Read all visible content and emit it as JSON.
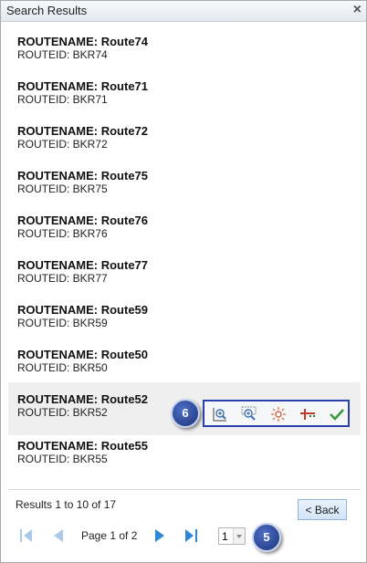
{
  "window": {
    "title": "Search Results",
    "close_label": "×"
  },
  "results": [
    {
      "name": "ROUTENAME: Route74",
      "id": "ROUTEID: BKR74"
    },
    {
      "name": "ROUTENAME: Route71",
      "id": "ROUTEID: BKR71"
    },
    {
      "name": "ROUTENAME: Route72",
      "id": "ROUTEID: BKR72"
    },
    {
      "name": "ROUTENAME: Route75",
      "id": "ROUTEID: BKR75"
    },
    {
      "name": "ROUTENAME: Route76",
      "id": "ROUTEID: BKR76"
    },
    {
      "name": "ROUTENAME: Route77",
      "id": "ROUTEID: BKR77"
    },
    {
      "name": "ROUTENAME: Route59",
      "id": "ROUTEID: BKR59"
    },
    {
      "name": "ROUTENAME: Route50",
      "id": "ROUTEID: BKR50"
    },
    {
      "name": "ROUTENAME: Route52",
      "id": "ROUTEID: BKR52"
    },
    {
      "name": "ROUTENAME: Route55",
      "id": "ROUTEID: BKR55"
    }
  ],
  "selected_index": 8,
  "toolbar": {
    "icons": [
      "zoom-to-feature-icon",
      "zoom-to-extent-icon",
      "highlight-icon",
      "route-measure-icon",
      "select-check-icon"
    ]
  },
  "callouts": {
    "toolbar": "6",
    "pager": "5"
  },
  "footer": {
    "count_text": "Results 1 to 10 of 17",
    "back_label": "< Back",
    "page_label": "Page 1 of 2",
    "page_select_value": "1"
  },
  "colors": {
    "accent": "#2d3fa8",
    "nav_blue": "#2f86d6",
    "badge": "#1c3479",
    "check_green": "#3b9a3b"
  }
}
